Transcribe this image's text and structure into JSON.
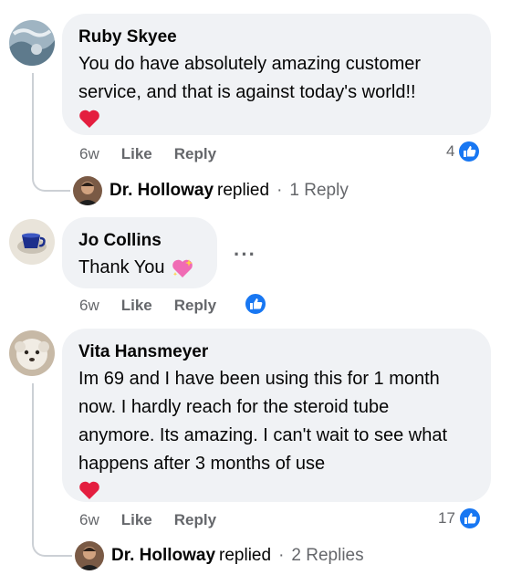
{
  "comments": [
    {
      "author": "Ruby Skyee",
      "text": "You do have absolutely amazing customer service, and that is against today's world!!",
      "time": "6w",
      "like_label": "Like",
      "reply_label": "Reply",
      "reaction_count": "4",
      "replies": {
        "name": "Dr. Holloway",
        "verb": "replied",
        "separator": "·",
        "count_text": "1 Reply"
      }
    },
    {
      "author": "Jo Collins",
      "text": "Thank You",
      "time": "6w",
      "like_label": "Like",
      "reply_label": "Reply",
      "more_label": "···"
    },
    {
      "author": "Vita Hansmeyer",
      "text": "Im 69 and I have been using this for 1 month now. I hardly reach for the steroid tube anymore. Its amazing. I can't wait to see what happens after 3 months of use",
      "time": "6w",
      "like_label": "Like",
      "reply_label": "Reply",
      "reaction_count": "17",
      "replies": {
        "name": "Dr. Holloway",
        "verb": "replied",
        "separator": "·",
        "count_text": "2 Replies"
      }
    }
  ],
  "colors": {
    "bubble": "#f0f2f5",
    "secondary_text": "#65676b",
    "like_blue": "#1877f2",
    "heart_red": "#e41e3f"
  }
}
